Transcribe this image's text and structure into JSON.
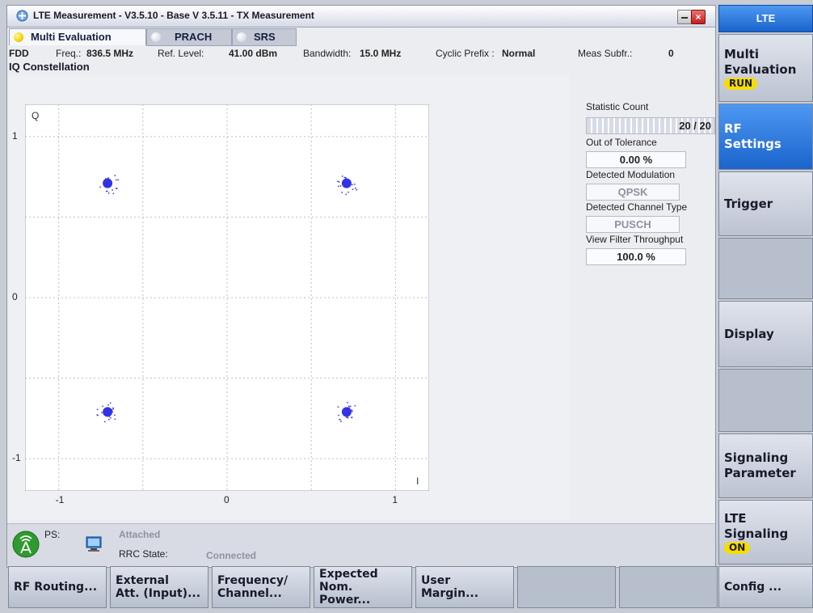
{
  "window": {
    "title": "LTE Measurement - V3.5.10 - Base V 3.5.11 - TX Measurement",
    "close_symbol": "×"
  },
  "tabs": [
    {
      "label": "Multi Evaluation",
      "active": true
    },
    {
      "label": "PRACH",
      "active": false
    },
    {
      "label": "SRS",
      "active": false
    }
  ],
  "info": {
    "mode": "FDD",
    "freq_label": "Freq.:",
    "freq_value": "836.5 MHz",
    "ref_level_label": "Ref. Level:",
    "ref_level_value": "41.00 dBm",
    "bandwidth_label": "Bandwidth:",
    "bandwidth_value": "15.0 MHz",
    "cyclic_prefix_label": "Cyclic Prefix :",
    "cyclic_prefix_value": "Normal",
    "meas_subfr_label": "Meas Subfr.:",
    "meas_subfr_value": "0"
  },
  "section_title": "IQ Constellation",
  "chart_data": {
    "type": "scatter",
    "title": "IQ Constellation",
    "xlabel": "I",
    "ylabel": "Q",
    "xlim": [
      -1.2,
      1.2
    ],
    "ylim": [
      -1.2,
      1.2
    ],
    "x_ticks": [
      "-1",
      "0",
      "1"
    ],
    "y_ticks": [
      "1",
      "0",
      "-1"
    ],
    "grid": true,
    "points": [
      {
        "x": -0.71,
        "y": 0.71
      },
      {
        "x": 0.71,
        "y": 0.71
      },
      {
        "x": -0.71,
        "y": -0.71
      },
      {
        "x": 0.71,
        "y": -0.71
      }
    ],
    "point_color": "#3232e6"
  },
  "stats": {
    "statistic_count_label": "Statistic Count",
    "statistic_count_value": "20 / 20",
    "out_of_tolerance_label": "Out of Tolerance",
    "out_of_tolerance_value": "0.00 %",
    "detected_modulation_label": "Detected Modulation",
    "detected_modulation_value": "QPSK",
    "detected_channel_type_label": "Detected Channel Type",
    "detected_channel_type_value": "PUSCH",
    "view_filter_label": "View Filter Throughput",
    "view_filter_value": "100.0 %"
  },
  "status": {
    "ps_label": "PS:",
    "ps_value": "Attached",
    "rrc_label": "RRC State:",
    "rrc_value": "Connected"
  },
  "bottom_keys": [
    {
      "line1": "RF Routing...",
      "line2": ""
    },
    {
      "line1": "External",
      "line2": "Att. (Input)..."
    },
    {
      "line1": "Frequency/",
      "line2": "Channel..."
    },
    {
      "line1": "Expected",
      "line2": "Nom. Power..."
    },
    {
      "line1": "User Margin...",
      "line2": ""
    },
    {
      "line1": "",
      "line2": ""
    },
    {
      "line1": "",
      "line2": ""
    },
    {
      "line1": "Config ...",
      "line2": ""
    }
  ],
  "right_keys": {
    "header": "LTE",
    "multi_eval_line1": "Multi",
    "multi_eval_line2": "Evaluation",
    "multi_eval_badge": "RUN",
    "rf_settings_line1": "RF",
    "rf_settings_line2": "Settings",
    "trigger": "Trigger",
    "display": "Display",
    "signaling_line1": "Signaling",
    "signaling_line2": "Parameter",
    "lte_signaling_line1": "LTE",
    "lte_signaling_line2": "Signaling",
    "lte_signaling_badge": "ON"
  },
  "colors": {
    "accent_blue": "#1a64cc",
    "badge_yellow": "#f6dd00",
    "constellation_dots": "#3232e6"
  }
}
